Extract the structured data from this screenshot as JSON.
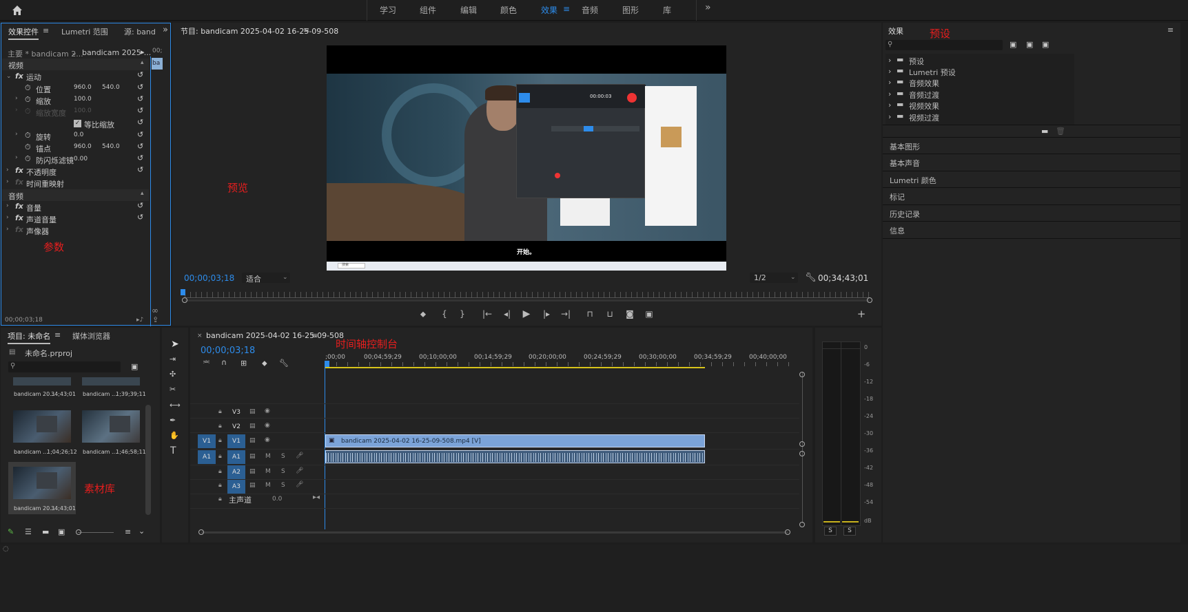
{
  "topbar": {
    "tabs": [
      "学习",
      "组件",
      "编辑",
      "颜色",
      "效果",
      "音频",
      "图形",
      "库"
    ],
    "active_index": 4,
    "more": "»"
  },
  "effect_controls": {
    "tab1": "效果控件",
    "tab2": "Lumetri 范围",
    "tab3": "源: band",
    "master": "主要 * bandicam 2...",
    "clip": "bandicam 2025-...",
    "mini_time": "00;",
    "mini_clip": "ba",
    "video_header": "视频",
    "audio_header": "音频",
    "motion": "运动",
    "position": "位置",
    "pos_x": "960.0",
    "pos_y": "540.0",
    "scale": "缩放",
    "scale_val": "100.0",
    "scale_width": "缩放宽度",
    "scale_width_val": "100.0",
    "uniform": "等比缩放",
    "rotation": "旋转",
    "rotation_val": "0.0",
    "anchor": "锚点",
    "anchor_x": "960.0",
    "anchor_y": "540.0",
    "flicker": "防闪烁滤镜",
    "flicker_val": "0.00",
    "opacity": "不透明度",
    "remap": "时间重映射",
    "volume": "音量",
    "channel_volume": "声道音量",
    "panner": "声像器",
    "timecode": "00;00;03;18",
    "annotation": "参数",
    "fx": "fx"
  },
  "program": {
    "title": "节目: bandicam 2025-04-02 16-25-09-508",
    "timecode": "00;00;03;18",
    "fit": "适合",
    "ratio": "1/2",
    "duration": "00;34;43;01",
    "annotation": "预览",
    "subtitle": "开始。"
  },
  "effects": {
    "title": "效果",
    "annotation": "预设",
    "folders": [
      "预设",
      "Lumetri 预设",
      "音频效果",
      "音频过渡",
      "视频效果",
      "视频过渡"
    ],
    "panels": [
      "基本图形",
      "基本声音",
      "Lumetri 颜色",
      "标记",
      "历史记录",
      "信息"
    ]
  },
  "project": {
    "tab1": "项目: 未命名",
    "tab2": "媒体浏览器",
    "file": "未命名.prproj",
    "annotation": "素材库",
    "clips": [
      {
        "name": "bandicam 20...",
        "dur": "34;43;01"
      },
      {
        "name": "bandicam ...",
        "dur": "1;39;39;11"
      },
      {
        "name": "bandicam ...",
        "dur": "1;04;26;12"
      },
      {
        "name": "bandicam ...",
        "dur": "1;46;58;11"
      },
      {
        "name": "bandicam 20...",
        "dur": "34;43;01"
      }
    ]
  },
  "timeline": {
    "title": "bandicam 2025-04-02 16-25-09-508",
    "timecode": "00;00;03;18",
    "annotation": "时间轴控制台",
    "ruler": [
      ";00;00",
      "00;04;59;29",
      "00;10;00;00",
      "00;14;59;29",
      "00;20;00;00",
      "00;24;59;29",
      "00;30;00;00",
      "00;34;59;29",
      "00;40;00;00"
    ],
    "video_tracks": [
      "V3",
      "V2",
      "V1"
    ],
    "audio_tracks": [
      "A1",
      "A2",
      "A3"
    ],
    "src_v": "V1",
    "src_a": "A1",
    "master": "主声道",
    "master_val": "0.0",
    "clip_label": "bandicam 2025-04-02 16-25-09-508.mp4 [V]",
    "m": "M",
    "s": "S"
  },
  "meter": {
    "scale": [
      "0",
      "-6",
      "-12",
      "-18",
      "-24",
      "-30",
      "-36",
      "-42",
      "-48",
      "-54",
      "dB"
    ],
    "solo": [
      "S",
      "S"
    ]
  },
  "screen_content": {
    "rec_time": "00:00:03",
    "search": "搜索"
  }
}
